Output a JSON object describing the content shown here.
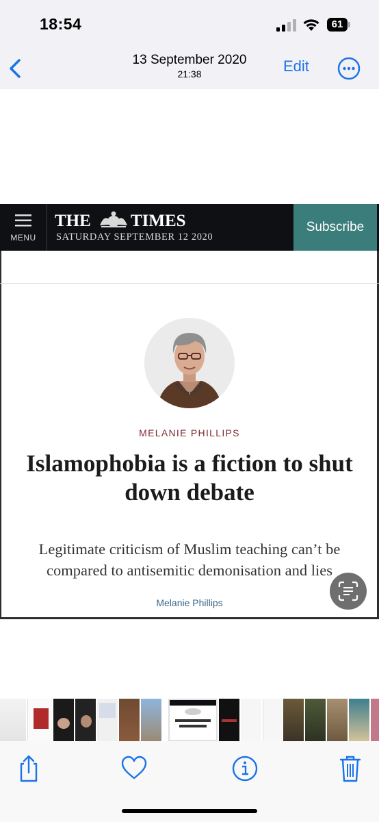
{
  "status_bar": {
    "time": "18:54",
    "battery": "61"
  },
  "nav": {
    "date": "13 September 2020",
    "time": "21:38",
    "edit_label": "Edit"
  },
  "article": {
    "header": {
      "menu_label": "MENU",
      "logo_left": "THE",
      "logo_right": "TIMES",
      "date": "SATURDAY SEPTEMBER 12 2020",
      "subscribe_label": "Subscribe"
    },
    "author_caps": "MELANIE PHILLIPS",
    "headline": "Islamophobia is a fiction to shut down debate",
    "standfirst": "Legitimate criticism of Muslim teaching can’t be compared to antisemitic demonisation and lies",
    "byline": "Melanie Phillips"
  },
  "colors": {
    "accent": "#1a73e8",
    "times_header": "#0f1014",
    "subscribe": "#3a7d7b",
    "author_caps": "#7a2b33",
    "byline": "#3c6587"
  },
  "icons": [
    "back-chevron-icon",
    "more-icon",
    "hamburger-icon",
    "live-text-icon",
    "share-icon",
    "heart-icon",
    "info-icon",
    "trash-icon"
  ]
}
